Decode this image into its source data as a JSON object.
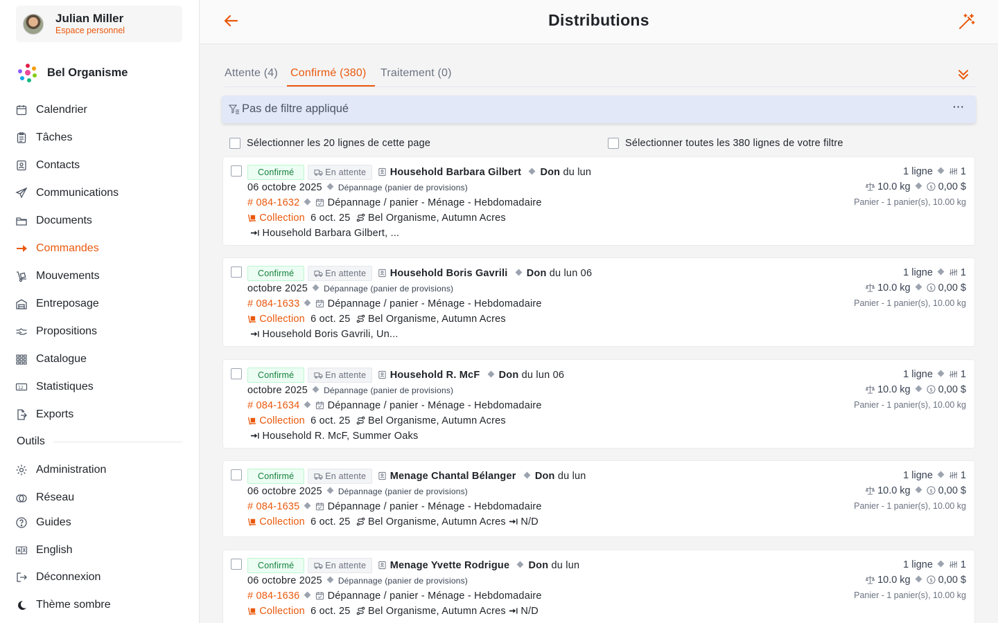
{
  "user": {
    "name": "Julian Miller",
    "subtitle": "Espace personnel"
  },
  "org": {
    "name": "Bel Organisme"
  },
  "nav": [
    {
      "label": "Calendrier",
      "icon": "calendar-icon"
    },
    {
      "label": "Tâches",
      "icon": "clipboard-icon"
    },
    {
      "label": "Contacts",
      "icon": "contact-card-icon"
    },
    {
      "label": "Communications",
      "icon": "send-icon"
    },
    {
      "label": "Documents",
      "icon": "folder-icon"
    },
    {
      "label": "Commandes",
      "icon": "arrow-right-icon"
    },
    {
      "label": "Mouvements",
      "icon": "dolly-icon"
    },
    {
      "label": "Entreposage",
      "icon": "warehouse-icon"
    },
    {
      "label": "Propositions",
      "icon": "handshake-icon"
    },
    {
      "label": "Catalogue",
      "icon": "grid-icon"
    },
    {
      "label": "Statistiques",
      "icon": "stats-icon"
    },
    {
      "label": "Exports",
      "icon": "export-icon"
    }
  ],
  "tools_label": "Outils",
  "tools": [
    {
      "label": "Administration",
      "icon": "gear-icon"
    },
    {
      "label": "Réseau",
      "icon": "network-icon"
    },
    {
      "label": "Guides",
      "icon": "help-icon"
    },
    {
      "label": "English",
      "icon": "language-icon"
    },
    {
      "label": "Déconnexion",
      "icon": "logout-icon"
    },
    {
      "label": "Thème sombre",
      "icon": "moon-icon"
    }
  ],
  "header": {
    "title": "Distributions"
  },
  "tabs": [
    {
      "label": "Attente (4)"
    },
    {
      "label": "Confirmé (380)"
    },
    {
      "label": "Traitement (0)"
    }
  ],
  "filter": {
    "text": "Pas de filtre appliqué",
    "more": "···"
  },
  "select_page": "Sélectionner les 20 lignes de cette page",
  "select_all": "Sélectionner toutes les 380 lignes de votre filtre",
  "colors": {
    "accent": "#ea580c",
    "confirm_bg": "#ecfdf3",
    "filter_bg": "#e2e8f8"
  },
  "cards": [
    {
      "status": "Confirmé",
      "state": "En attente",
      "household": "Household Barbara Gilbert",
      "don": "Don",
      "don_rest": "du lun",
      "date_line": "06 octobre 2025",
      "program": "Dépannage (panier de provisions)",
      "ref": "# 084-1632",
      "activity": "Dépannage / panier - Ménage - Hebdomadaire",
      "collection": "Collection",
      "date_short": "6 oct. 25",
      "site": "Bel Organisme, Autumn Acres",
      "dest": "Household Barbara Gilbert, ...",
      "lines": "1 ligne",
      "count": "1",
      "weight": "10.0 kg",
      "amount": "0,00 $",
      "summary": "Panier - 1 panier(s), 10.00 kg"
    },
    {
      "status": "Confirmé",
      "state": "En attente",
      "household": "Household Boris Gavrili",
      "don": "Don",
      "don_rest": "du lun 06",
      "date_line": "octobre 2025",
      "program": "Dépannage (panier de provisions)",
      "ref": "# 084-1633",
      "activity": "Dépannage / panier - Ménage - Hebdomadaire",
      "collection": "Collection",
      "date_short": "6 oct. 25",
      "site": "Bel Organisme, Autumn Acres",
      "dest": "Household Boris Gavrili, Un...",
      "lines": "1 ligne",
      "count": "1",
      "weight": "10.0 kg",
      "amount": "0,00 $",
      "summary": "Panier - 1 panier(s), 10.00 kg"
    },
    {
      "status": "Confirmé",
      "state": "En attente",
      "household": "Household R. McF",
      "don": "Don",
      "don_rest": "du lun 06",
      "date_line": "octobre 2025",
      "program": "Dépannage (panier de provisions)",
      "ref": "# 084-1634",
      "activity": "Dépannage / panier - Ménage - Hebdomadaire",
      "collection": "Collection",
      "date_short": "6 oct. 25",
      "site": "Bel Organisme, Autumn Acres",
      "dest": "Household R. McF, Summer Oaks",
      "lines": "1 ligne",
      "count": "1",
      "weight": "10.0 kg",
      "amount": "0,00 $",
      "summary": "Panier - 1 panier(s), 10.00 kg"
    },
    {
      "status": "Confirmé",
      "state": "En attente",
      "household": "Menage Chantal Bélanger",
      "don": "Don",
      "don_rest": "du lun",
      "date_line": "06 octobre 2025",
      "program": "Dépannage (panier de provisions)",
      "ref": "# 084-1635",
      "activity": "Dépannage / panier - Ménage - Hebdomadaire",
      "collection": "Collection",
      "date_short": "6 oct. 25",
      "site": "Bel Organisme, Autumn Acres",
      "dest": "N/D",
      "lines": "1 ligne",
      "count": "1",
      "weight": "10.0 kg",
      "amount": "0,00 $",
      "summary": "Panier - 1 panier(s), 10.00 kg"
    },
    {
      "status": "Confirmé",
      "state": "En attente",
      "household": "Menage Yvette Rodrigue",
      "don": "Don",
      "don_rest": "du lun",
      "date_line": "06 octobre 2025",
      "program": "Dépannage (panier de provisions)",
      "ref": "# 084-1636",
      "activity": "Dépannage / panier - Ménage - Hebdomadaire",
      "collection": "Collection",
      "date_short": "6 oct. 25",
      "site": "Bel Organisme, Autumn Acres",
      "dest": "N/D",
      "lines": "1 ligne",
      "count": "1",
      "weight": "10.0 kg",
      "amount": "0,00 $",
      "summary": "Panier - 1 panier(s), 10.00 kg"
    }
  ]
}
